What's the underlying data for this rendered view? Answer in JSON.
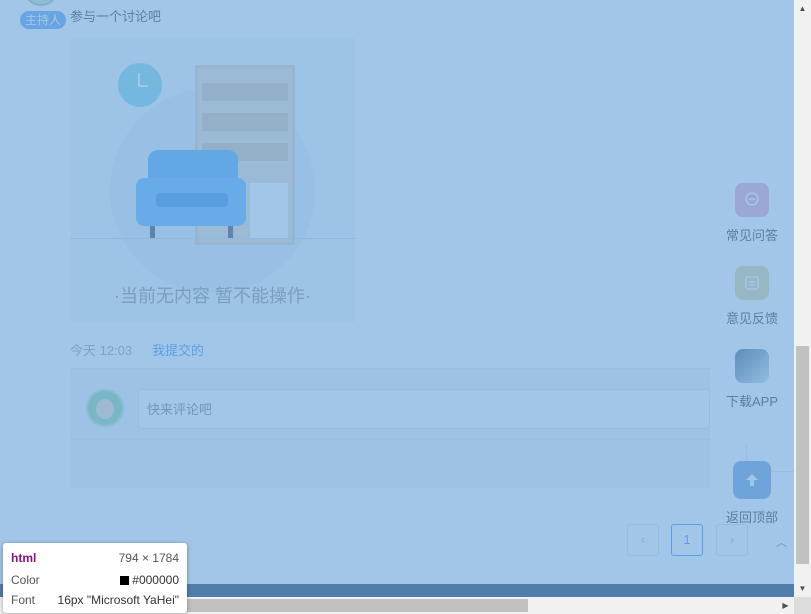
{
  "topic": {
    "host_badge": "主持人",
    "text": "参与一个讨论吧"
  },
  "empty_state": {
    "message": "·当前无内容 暂不能操作·"
  },
  "post_meta": {
    "time": "今天 12:03",
    "link": "我提交的"
  },
  "comment": {
    "placeholder": "快来评论吧"
  },
  "pagination": {
    "prev": "‹",
    "page": "1",
    "next": "›"
  },
  "floating_toolbar": {
    "faq": {
      "label": "常见问答",
      "icon": "chat-icon"
    },
    "feedback": {
      "label": "意见反馈",
      "icon": "feedback-icon"
    },
    "app": {
      "label": "下载APP",
      "icon": "app-icon"
    },
    "top": {
      "label": "返回顶部",
      "icon": "arrow-up-icon"
    }
  },
  "inspector": {
    "tag": "html",
    "size": "794 × 1784",
    "color_label": "Color",
    "color_value": "#000000",
    "font_label": "Font",
    "font_value": "16px \"Microsoft YaHei\""
  },
  "colors": {
    "accent": "#3d8ef0",
    "overlay": "#6fa8dc"
  }
}
